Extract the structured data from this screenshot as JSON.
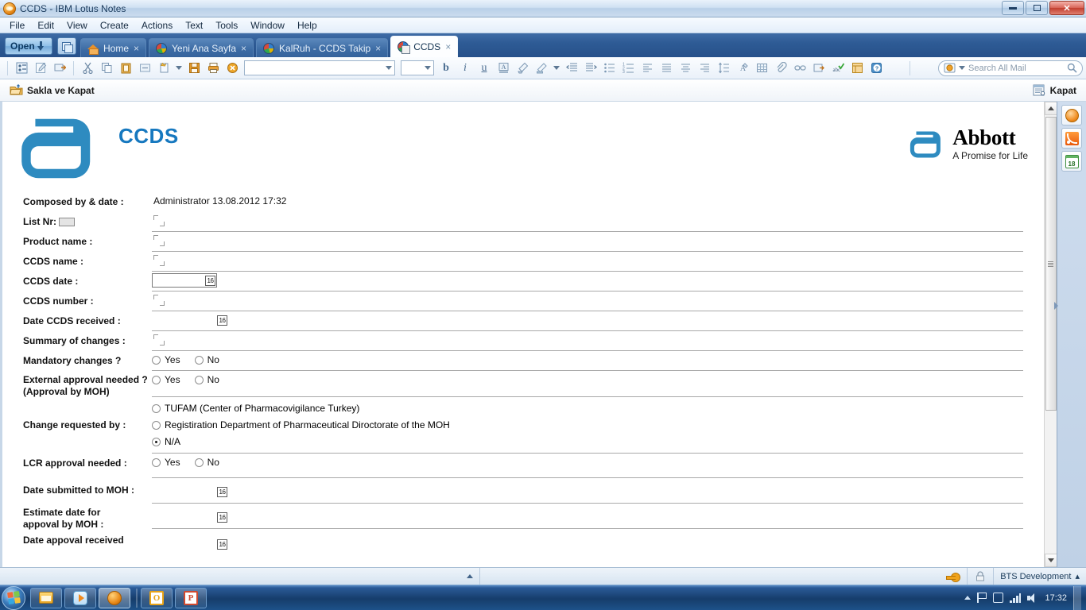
{
  "window": {
    "title": "CCDS - IBM Lotus Notes",
    "icon": "lotus-notes-icon",
    "minimize": "minimize",
    "restore": "restore",
    "close": "close"
  },
  "menubar": {
    "items": [
      "File",
      "Edit",
      "View",
      "Create",
      "Actions",
      "Text",
      "Tools",
      "Window",
      "Help"
    ]
  },
  "tabbar": {
    "open_button": "Open",
    "window_switcher": "window-switcher",
    "tabs": [
      {
        "label": "Home",
        "icon": "home-icon",
        "active": false,
        "close": "×"
      },
      {
        "label": "Yeni Ana Sayfa",
        "icon": "notes-db-icon",
        "active": false,
        "close": "×"
      },
      {
        "label": "KalRuh - CCDS Takip",
        "icon": "notes-db-icon",
        "active": false,
        "close": "×"
      },
      {
        "label": "CCDS",
        "icon": "notes-doc-icon",
        "active": true,
        "close": "×"
      }
    ]
  },
  "toolbar": {
    "group1": [
      "properties-icon",
      "edit-document-icon",
      "forward-icon"
    ],
    "group2": [
      "cut-icon",
      "copy-icon",
      "paste-icon",
      "paste-special-icon",
      "new-document-icon",
      "dropdown-icon",
      "save-icon",
      "print-icon",
      "delete-icon"
    ],
    "font_name_value": "",
    "font_size_value": "",
    "format_buttons": [
      "bold",
      "italic",
      "underline",
      "font-color",
      "highlighter",
      "text-style",
      "indent-less",
      "indent-more"
    ],
    "format_buttons2": [
      "bullet-list",
      "numbered-list",
      "align-left",
      "align-center",
      "align-right",
      "align-justify",
      "line-spacing",
      "permanent-pen",
      "table",
      "attach",
      "link",
      "section",
      "spell-check",
      "margins",
      "help"
    ],
    "search_placeholder": "Search All Mail",
    "search_scope_icon": "mail-scope-icon",
    "search_icon": "magnifier-icon"
  },
  "actionbar": {
    "save_close_label": "Sakla ve Kapat",
    "save_close_icon": "save-folder-icon",
    "close_label": "Kapat",
    "close_icon": "close-doc-icon"
  },
  "document": {
    "brand_logo": "abbott-a-logo",
    "app_title": "CCDS",
    "brand_name": "Abbott",
    "brand_tagline": "A Promise for Life",
    "brand_mark": "abbott-a-mark",
    "accent_color": "#1678bf",
    "fields": [
      {
        "label": "Composed by & date :",
        "type": "text",
        "value": "Administrator   13.08.2012 17:32",
        "name": "composed-by-and-date"
      },
      {
        "label": "List Nr:",
        "label_has_box": true,
        "type": "richtext",
        "value": "",
        "name": "list-nr"
      },
      {
        "label": "Product name :",
        "type": "richtext",
        "value": "",
        "name": "product-name"
      },
      {
        "label": "CCDS name :",
        "type": "richtext",
        "value": "",
        "name": "ccds-name"
      },
      {
        "label": "CCDS date :",
        "type": "date",
        "value": "",
        "boxed": true,
        "calendar_glyph": "16",
        "name": "ccds-date"
      },
      {
        "label": "CCDS number :",
        "type": "richtext",
        "value": "",
        "name": "ccds-number"
      },
      {
        "label": "Date CCDS received :",
        "type": "date",
        "value": "",
        "boxed": false,
        "calendar_glyph": "16",
        "name": "date-ccds-received"
      },
      {
        "label": "Summary of changes :",
        "type": "richtext",
        "value": "",
        "name": "summary-of-changes"
      },
      {
        "label": "Mandatory changes ?",
        "type": "radio-inline",
        "options": [
          {
            "label": "Yes",
            "selected": false
          },
          {
            "label": "No",
            "selected": false
          }
        ],
        "name": "mandatory-changes"
      },
      {
        "label": "External approval needed ?\n(Approval by MOH)",
        "label_line1": "External approval needed ?",
        "label_line2": "(Approval by MOH)",
        "type": "radio-inline",
        "options": [
          {
            "label": "Yes",
            "selected": false
          },
          {
            "label": "No",
            "selected": false
          }
        ],
        "name": "external-approval-needed"
      },
      {
        "label": "Change requested by :",
        "type": "radio-stack",
        "options": [
          {
            "label": "TUFAM (Center of Pharmacovigilance Turkey)",
            "selected": false
          },
          {
            "label": "Registiration Department of Pharmaceutical Diroctorate of the MOH",
            "selected": false
          },
          {
            "label": "N/A",
            "selected": true
          }
        ],
        "name": "change-requested-by"
      },
      {
        "label": "LCR approval needed :",
        "type": "radio-inline",
        "options": [
          {
            "label": "Yes",
            "selected": false
          },
          {
            "label": "No",
            "selected": false
          }
        ],
        "name": "lcr-approval-needed"
      },
      {
        "label": "Date submitted to MOH :",
        "type": "date",
        "value": "",
        "boxed": false,
        "calendar_glyph": "16",
        "name": "date-submitted-to-moh"
      },
      {
        "label": "Estimate date for appoval by MOH :",
        "label_line1": "Estimate date for",
        "label_line2": "appoval by MOH :",
        "type": "date",
        "value": "",
        "boxed": false,
        "calendar_glyph": "16",
        "name": "estimate-date-for-approval-by-moh"
      },
      {
        "label": "Date appoval received",
        "type": "date",
        "value": "",
        "boxed": false,
        "calendar_glyph": "16",
        "name": "date-approval-received"
      }
    ]
  },
  "sidebar": {
    "items": [
      {
        "name": "sametime-chat",
        "icon": "chat-bubble-icon"
      },
      {
        "name": "feeds",
        "icon": "rss-icon"
      },
      {
        "name": "day-at-a-glance",
        "icon": "calendar-icon",
        "badge": "18"
      }
    ]
  },
  "statusbar": {
    "expand_icon": "up-arrow-icon",
    "key_icon": "key-icon",
    "lock_icon": "lock-icon",
    "location_label": "BTS Development",
    "location_caret": "▴"
  },
  "taskbar": {
    "start": "start-orb",
    "buttons": [
      {
        "name": "windows-explorer",
        "icon": "folder-icon",
        "active": false
      },
      {
        "name": "windows-media-player",
        "icon": "media-play-icon",
        "active": false
      },
      {
        "name": "ibm-lotus-notes",
        "icon": "lotus-notes-icon",
        "active": true
      },
      {
        "name": "outlook",
        "icon": "outlook-o-icon",
        "active": false
      },
      {
        "name": "powerpoint",
        "icon": "powerpoint-p-icon",
        "active": false
      }
    ],
    "tray": {
      "show_hidden": "show-hidden-icons",
      "action_center": "flag-icon",
      "network_notice": "hand-icon",
      "network": "signal-icon",
      "volume": "speaker-icon",
      "clock": "17:32"
    }
  }
}
